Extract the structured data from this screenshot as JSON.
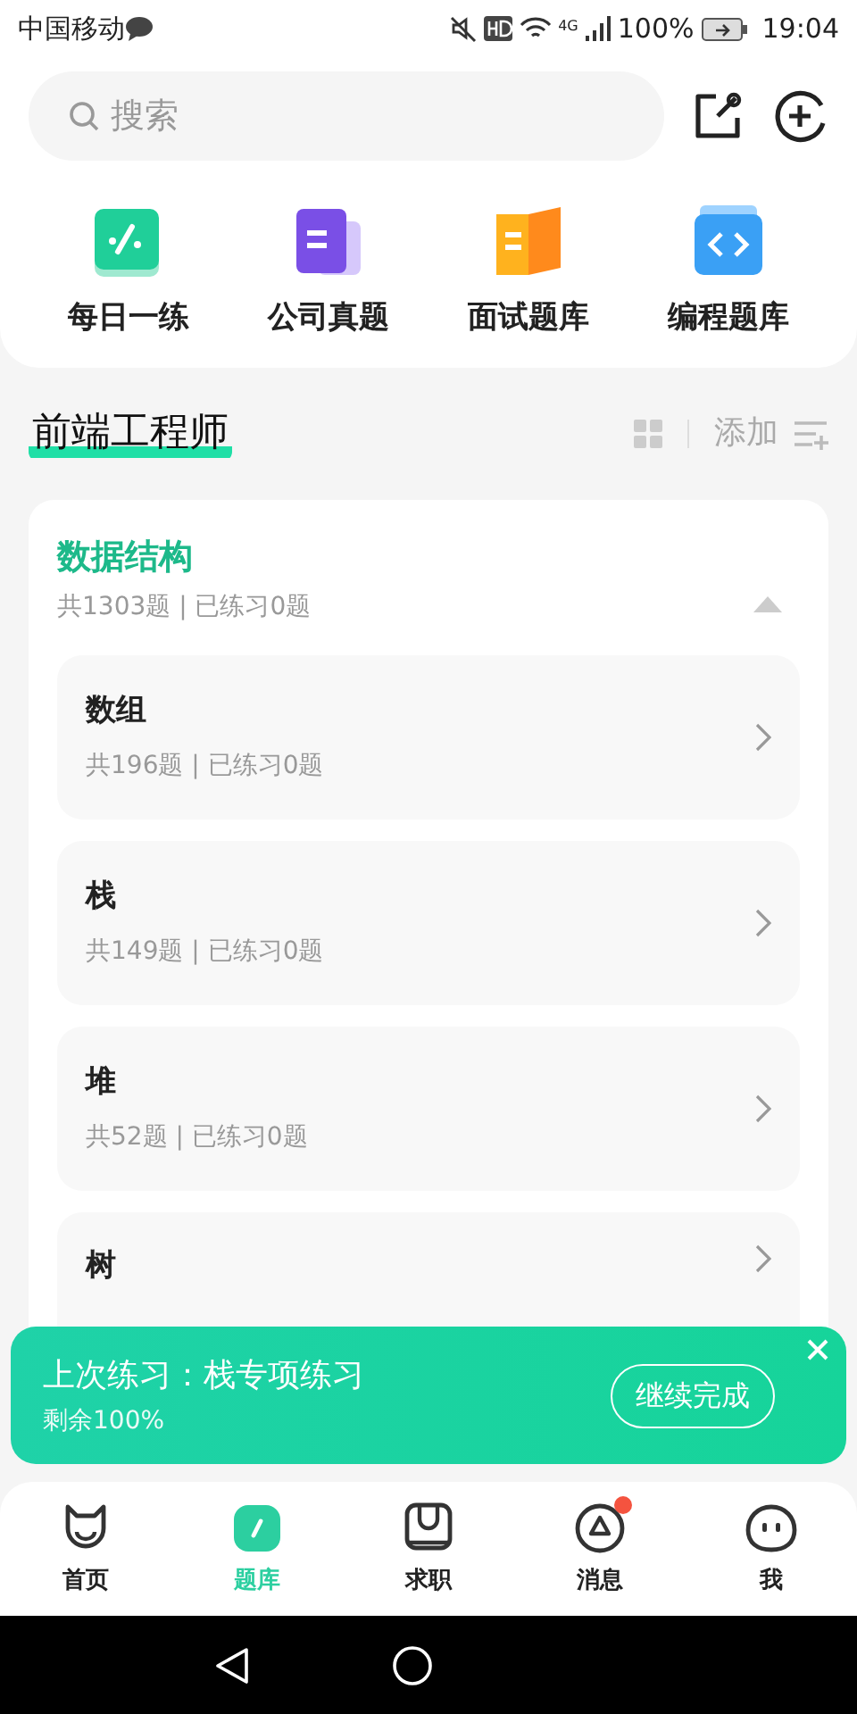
{
  "status_bar": {
    "carrier": "中国移动",
    "network": "4G",
    "battery": "100%",
    "time": "19:04"
  },
  "search": {
    "placeholder": "搜索"
  },
  "shortcuts": [
    {
      "label": "每日一练",
      "kind": "daily"
    },
    {
      "label": "公司真题",
      "kind": "company"
    },
    {
      "label": "面试题库",
      "kind": "interview"
    },
    {
      "label": "编程题库",
      "kind": "coding"
    }
  ],
  "section": {
    "title": "前端工程师",
    "add_label": "添加"
  },
  "category": {
    "title": "数据结构",
    "summary": "共1303题 | 已练习0题",
    "expanded": true,
    "items": [
      {
        "title": "数组",
        "summary": "共196题 | 已练习0题"
      },
      {
        "title": "栈",
        "summary": "共149题 | 已练习0题"
      },
      {
        "title": "堆",
        "summary": "共52题 | 已练习0题"
      },
      {
        "title": "树"
      }
    ]
  },
  "banner": {
    "title": "上次练习：栈专项练习",
    "subtitle": "剩余100%",
    "button": "继续完成"
  },
  "tabs": [
    {
      "label": "首页",
      "kind": "home",
      "selected": false,
      "badge": false
    },
    {
      "label": "题库",
      "kind": "bank",
      "selected": true,
      "badge": false
    },
    {
      "label": "求职",
      "kind": "jobs",
      "selected": false,
      "badge": false
    },
    {
      "label": "消息",
      "kind": "messages",
      "selected": false,
      "badge": true
    },
    {
      "label": "我",
      "kind": "me",
      "selected": false,
      "badge": false
    }
  ]
}
